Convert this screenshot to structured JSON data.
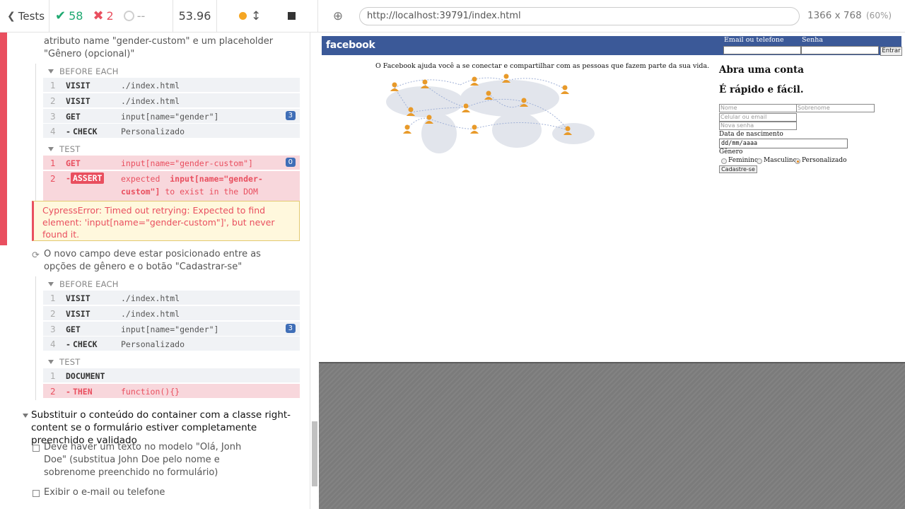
{
  "header": {
    "back_label": "Tests",
    "passed": "58",
    "failed": "2",
    "pending": "--",
    "duration": "53.96"
  },
  "reporter": {
    "test1_title_partial": "atributo name \"gender-custom\" e um placeholder \"Gênero (opcional)\"",
    "before_each_label": "BEFORE EACH",
    "test_label": "TEST",
    "before_each_cmds": [
      {
        "n": "1",
        "name": "VISIT",
        "msg": "./index.html"
      },
      {
        "n": "2",
        "name": "VISIT",
        "msg": "./index.html"
      },
      {
        "n": "3",
        "name": "GET",
        "msg": "input[name=\"gender\"]",
        "badge": "3"
      },
      {
        "n": "4",
        "name": "CHECK",
        "msg": "Personalizado"
      }
    ],
    "test1_cmds": {
      "get": {
        "n": "1",
        "name": "GET",
        "msg": "input[name=\"gender-custom\"]",
        "badge": "0"
      },
      "assert": {
        "n": "2",
        "name": "ASSERT",
        "msg_pre": "expected",
        "msg_bold": "input[name=\"gender-custom\"]",
        "msg_post": "to exist in the DOM"
      }
    },
    "error_text": "CypressError: Timed out retrying: Expected to find element: 'input[name=\"gender-custom\"]', but never found it.",
    "test2_title": "O novo campo deve estar posicionado entre as opções de gênero e o botão \"Cadastrar-se\"",
    "test2_cmds": [
      {
        "n": "1",
        "name": "DOCUMENT",
        "msg": ""
      },
      {
        "n": "2",
        "name": "THEN",
        "msg": "function(){}"
      }
    ],
    "suite_title": "Substituir o conteúdo do container com a classe right-content se o formulário estiver completamente preenchido e validado",
    "test3_title": "Deve haver um texto no modelo \"Olá, Jonh Doe\" (substitua John Doe pelo nome e sobrenome preenchido no formulário)",
    "test4_title": "Exibir o e-mail ou telefone"
  },
  "aut": {
    "url": "http://localhost:39791/index.html",
    "viewport": "1366 x 768",
    "viewport_pct": "(60%)"
  },
  "fb": {
    "logo": "facebook",
    "email_label": "Email ou telefone",
    "senha_label": "Senha",
    "entrar": "Entrar",
    "tagline": "O Facebook ajuda você a se conectar e compartilhar com as pessoas que fazem parte da sua vida.",
    "h1": "Abra uma conta",
    "h2": "É rápido e fácil.",
    "ph_nome": "Nome",
    "ph_sobrenome": "Sobrenome",
    "ph_celular": "Celular ou email",
    "ph_senha": "Nova senha",
    "nascimento_label": "Data de nascimento",
    "date_value": "dd/mm/aaaa",
    "genero_label": "Gênero",
    "opt_fem": "Feminino",
    "opt_masc": "Masculino",
    "opt_pers": "Personalizado",
    "submit": "Cadastre-se"
  },
  "colors": {
    "fail": "#e94f5f",
    "pass": "#1fa971",
    "fb_blue": "#3b5998"
  }
}
